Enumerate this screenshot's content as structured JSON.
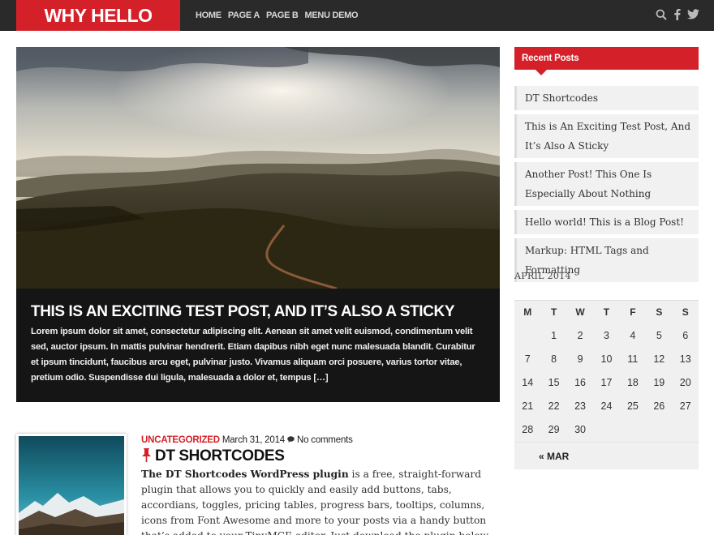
{
  "site": {
    "logo": "WHY HELLO THERE",
    "nav": [
      "HOME",
      "PAGE A",
      "PAGE B",
      "MENU DEMO"
    ],
    "header_icons": [
      "search-icon",
      "facebook-icon",
      "twitter-icon"
    ],
    "accent_color": "#d42028",
    "header_color": "#2a2a2a"
  },
  "hero": {
    "title": "THIS IS AN EXCITING TEST POST, AND IT’S ALSO A STICKY",
    "excerpt": "Lorem ipsum dolor sit amet, consectetur adipiscing elit. Aenean sit amet velit euismod, condimentum velit sed, auctor ipsum. In mattis pulvinar hendrerit. Etiam dapibus nibh eget nunc malesuada blandit. Curabitur et ipsum tincidunt, faucibus arcu eget, pulvinar justo. Vivamus aliquam orci posuere, varius tortor vitae, pretium odio. Suspendisse dui ligula, malesuada a dolor et, tempus […]"
  },
  "post": {
    "category": "UNCATEGORIZED",
    "date": "March 31, 2014",
    "comments": "No comments",
    "title": "DT SHORTCODES",
    "body_strong": "The DT Shortcodes WordPress plugin",
    "body_rest": " is a free, straight-forward plugin that allows you to quickly and easily add buttons, tabs, accordians, toggles, pricing tables, progress bars, tooltips, columns, icons from Font Awesome and more to your posts via a handy button that’s added to your TinyMCE editor. Just download the plugin below, upload to your site using the dashboard or"
  },
  "sidebar": {
    "recent_title": "Recent Posts",
    "recent_posts": [
      "DT Shortcodes",
      "This is An Exciting Test Post, And It’s Also A Sticky",
      "Another Post! This One Is Especially About Nothing",
      "Hello world! This is a Blog Post!",
      "Markup: HTML Tags and Formatting"
    ],
    "calendar": {
      "caption": "APRIL 2014",
      "days": [
        "M",
        "T",
        "W",
        "T",
        "F",
        "S",
        "S"
      ],
      "weeks": [
        [
          "",
          "1",
          "2",
          "3",
          "4",
          "5",
          "6"
        ],
        [
          "7",
          "8",
          "9",
          "10",
          "11",
          "12",
          "13"
        ],
        [
          "14",
          "15",
          "16",
          "17",
          "18",
          "19",
          "20"
        ],
        [
          "21",
          "22",
          "23",
          "24",
          "25",
          "26",
          "27"
        ],
        [
          "28",
          "29",
          "30",
          "",
          "",
          "",
          ""
        ]
      ],
      "prev_link": "« MAR"
    }
  }
}
